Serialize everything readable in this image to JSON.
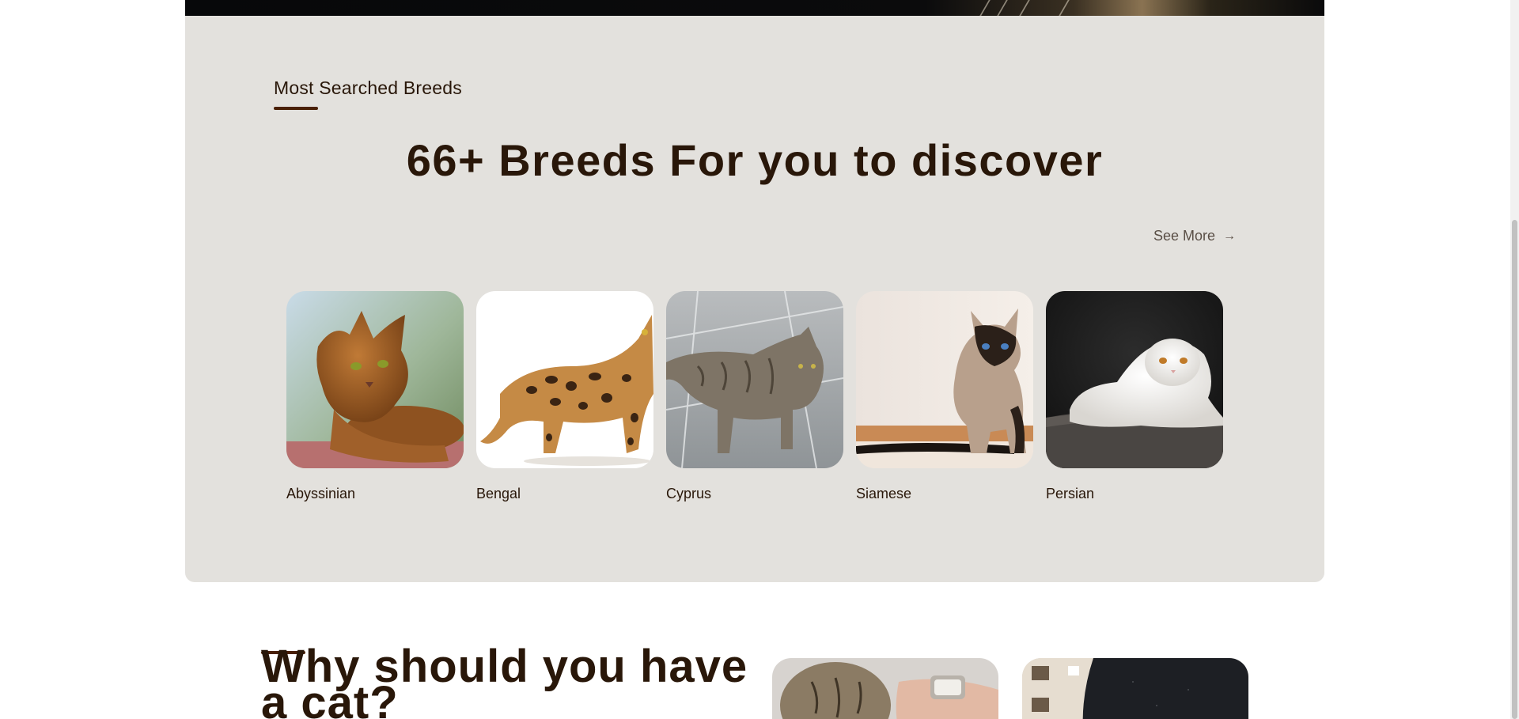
{
  "breeds_section": {
    "eyebrow": "Most Searched Breeds",
    "heading": "66+ Breeds For you to discover",
    "see_more_label": "See More",
    "see_more_arrow": "→",
    "breeds": [
      {
        "name": "Abyssinian"
      },
      {
        "name": "Bengal"
      },
      {
        "name": "Cyprus"
      },
      {
        "name": "Siamese"
      },
      {
        "name": "Persian"
      }
    ]
  },
  "why_section": {
    "heading": "Why should you have a cat?"
  },
  "colors": {
    "section_background": "#e3e1dd",
    "heading_text": "#291709",
    "accent_underline": "#4a2006",
    "muted_text": "#5a4f46"
  }
}
